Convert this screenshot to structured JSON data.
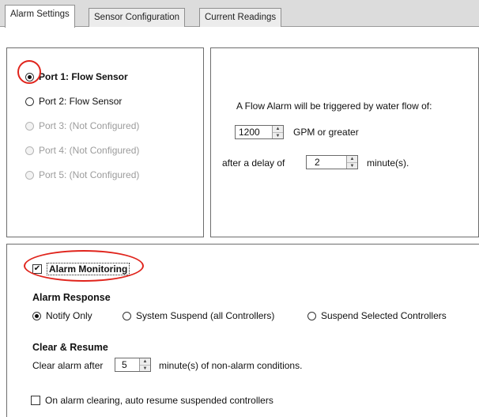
{
  "tabs": [
    "Alarm Settings",
    "Sensor Configuration",
    "Current Readings"
  ],
  "ports": [
    {
      "label": "Port 1:  Flow Sensor",
      "selected": true,
      "enabled": true
    },
    {
      "label": "Port 2:  Flow Sensor",
      "selected": false,
      "enabled": true
    },
    {
      "label": "Port 3:  (Not Configured)",
      "selected": false,
      "enabled": false
    },
    {
      "label": "Port 4:  (Not Configured)",
      "selected": false,
      "enabled": false
    },
    {
      "label": "Port 5:  (Not Configured)",
      "selected": false,
      "enabled": false
    }
  ],
  "flow_alarm": {
    "description": "A Flow Alarm will be triggered by water flow of:",
    "flow_value": "1200",
    "flow_unit": "GPM or greater",
    "delay_label": "after a delay of",
    "delay_value": "2",
    "delay_unit": "minute(s)."
  },
  "alarm_monitoring": {
    "label": "Alarm Monitoring",
    "checked": true,
    "response_heading": "Alarm Response",
    "responses": [
      {
        "label": "Notify Only",
        "selected": true
      },
      {
        "label": "System Suspend (all Controllers)",
        "selected": false
      },
      {
        "label": "Suspend Selected Controllers",
        "selected": false
      }
    ],
    "clear_heading": "Clear & Resume",
    "clear_label": "Clear alarm after",
    "clear_value": "5",
    "clear_unit": "minute(s) of non-alarm conditions.",
    "auto_resume_label": "On alarm clearing, auto resume suspended controllers",
    "auto_resume_checked": false
  },
  "colors": {
    "highlight": "#e0241c"
  }
}
